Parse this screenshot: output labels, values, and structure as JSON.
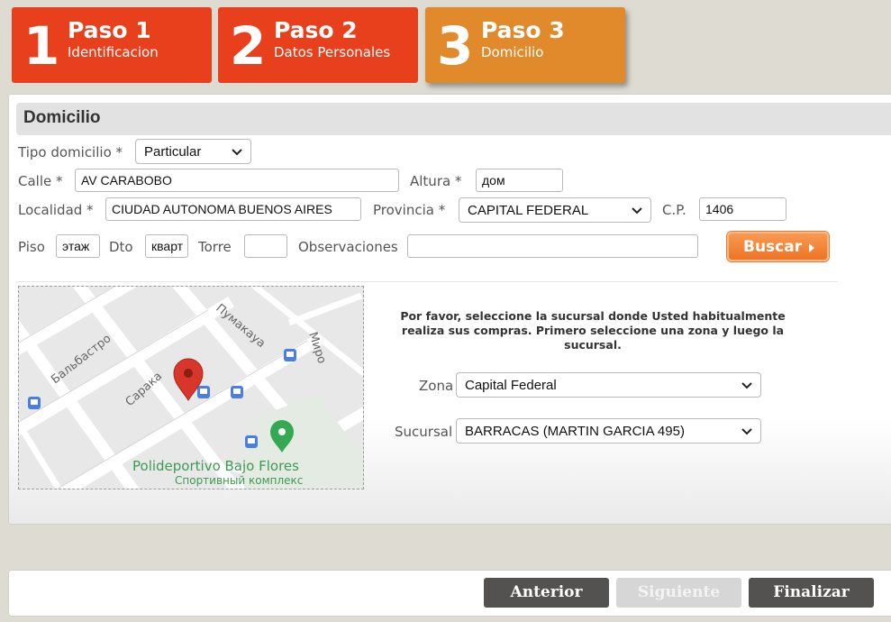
{
  "steps": [
    {
      "number": "1",
      "title": "Paso 1",
      "subtitle": "Identificacion"
    },
    {
      "number": "2",
      "title": "Paso 2",
      "subtitle": "Datos Personales"
    },
    {
      "number": "3",
      "title": "Paso 3",
      "subtitle": "Domicilio"
    }
  ],
  "section": {
    "title": "Domicilio"
  },
  "form": {
    "tipo_label": "Tipo domicilio *",
    "tipo_value": "Particular",
    "calle_label": "Calle *",
    "calle_value": "AV CARABOBO",
    "altura_label": "Altura *",
    "altura_value": "дом",
    "localidad_label": "Localidad *",
    "localidad_value": "CIUDAD AUTONOMA BUENOS AIRES",
    "provincia_label": "Provincia *",
    "provincia_value": "CAPITAL FEDERAL",
    "cp_label": "C.P.",
    "cp_value": "1406",
    "piso_label": "Piso",
    "piso_value": "этаж",
    "dto_label": "Dto",
    "dto_value": "кварт",
    "torre_label": "Torre",
    "torre_value": "",
    "observaciones_label": "Observaciones",
    "observaciones_value": "",
    "buscar_label": "Buscar"
  },
  "map": {
    "streets": [
      "Бальбастро",
      "Пумакауа",
      "Миро",
      "Сарака"
    ],
    "place_name": "Polideportivo Bajo Flores",
    "place_subtitle": "Спортивный комплекс"
  },
  "branch": {
    "instructions_line1": "Por favor, seleccione la sucursal donde Usted habitualmente",
    "instructions_line2": "realiza sus compras. Primero seleccione una zona y luego la sucursal.",
    "zona_label": "Zona",
    "zona_value": "Capital Federal",
    "sucursal_label": "Sucursal",
    "sucursal_value": "BARRACAS (MARTIN GARCIA 495)"
  },
  "footer": {
    "anterior": "Anterior",
    "siguiente": "Siguiente",
    "finalizar": "Finalizar"
  },
  "colors": {
    "step_active": "#e08a2c",
    "step_inactive": "#e8401c",
    "button_dark": "#545151",
    "buscar": "#ef7424"
  }
}
